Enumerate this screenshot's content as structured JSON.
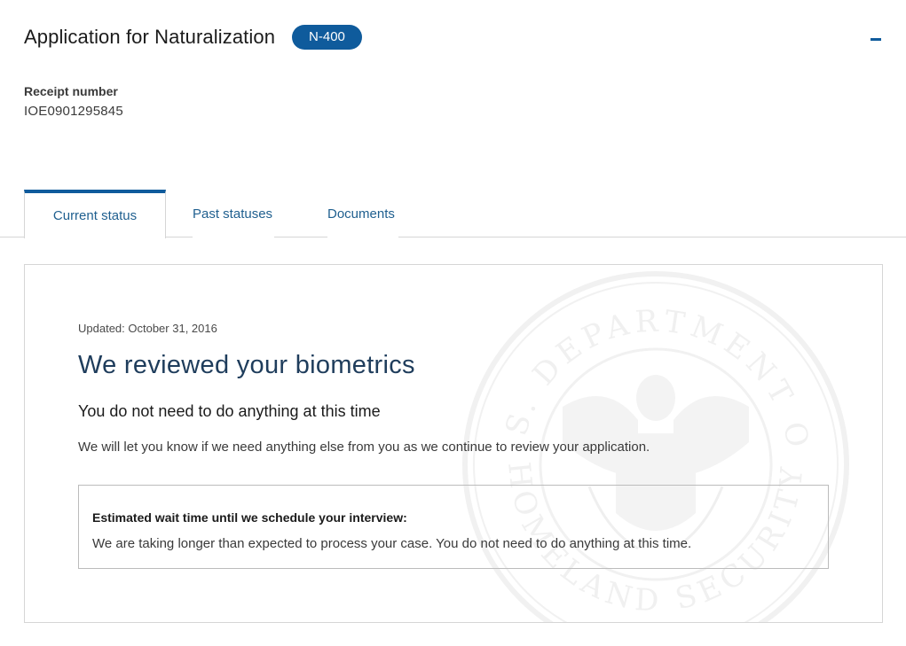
{
  "header": {
    "title": "Application for Naturalization",
    "form_badge": "N-400",
    "collapse_icon": "minus-icon"
  },
  "receipt": {
    "label": "Receipt number",
    "value": "IOE0901295845"
  },
  "tabs": [
    {
      "label": "Current status",
      "active": true
    },
    {
      "label": "Past statuses",
      "active": false
    },
    {
      "label": "Documents",
      "active": false
    }
  ],
  "status": {
    "updated": "Updated: October 31, 2016",
    "title": "We reviewed your biometrics",
    "subtitle": "You do not need to do anything at this time",
    "description": "We will let you know if we need anything else from you as we continue to review your application.",
    "wait_label": "Estimated wait time until we schedule your interview:",
    "wait_text": "We are taking longer than expected to process your case. You do not need to do anything at this time.",
    "watermark": "dhs-seal-watermark",
    "watermark_text_top": "U.S. DEPARTMENT OF",
    "watermark_text_bottom": "HOMELAND SECURITY"
  },
  "colors": {
    "accent": "#0f5b9c",
    "tab_text": "#1f5f8f",
    "title_text": "#1f3d5c",
    "border": "#d6d6d6"
  }
}
